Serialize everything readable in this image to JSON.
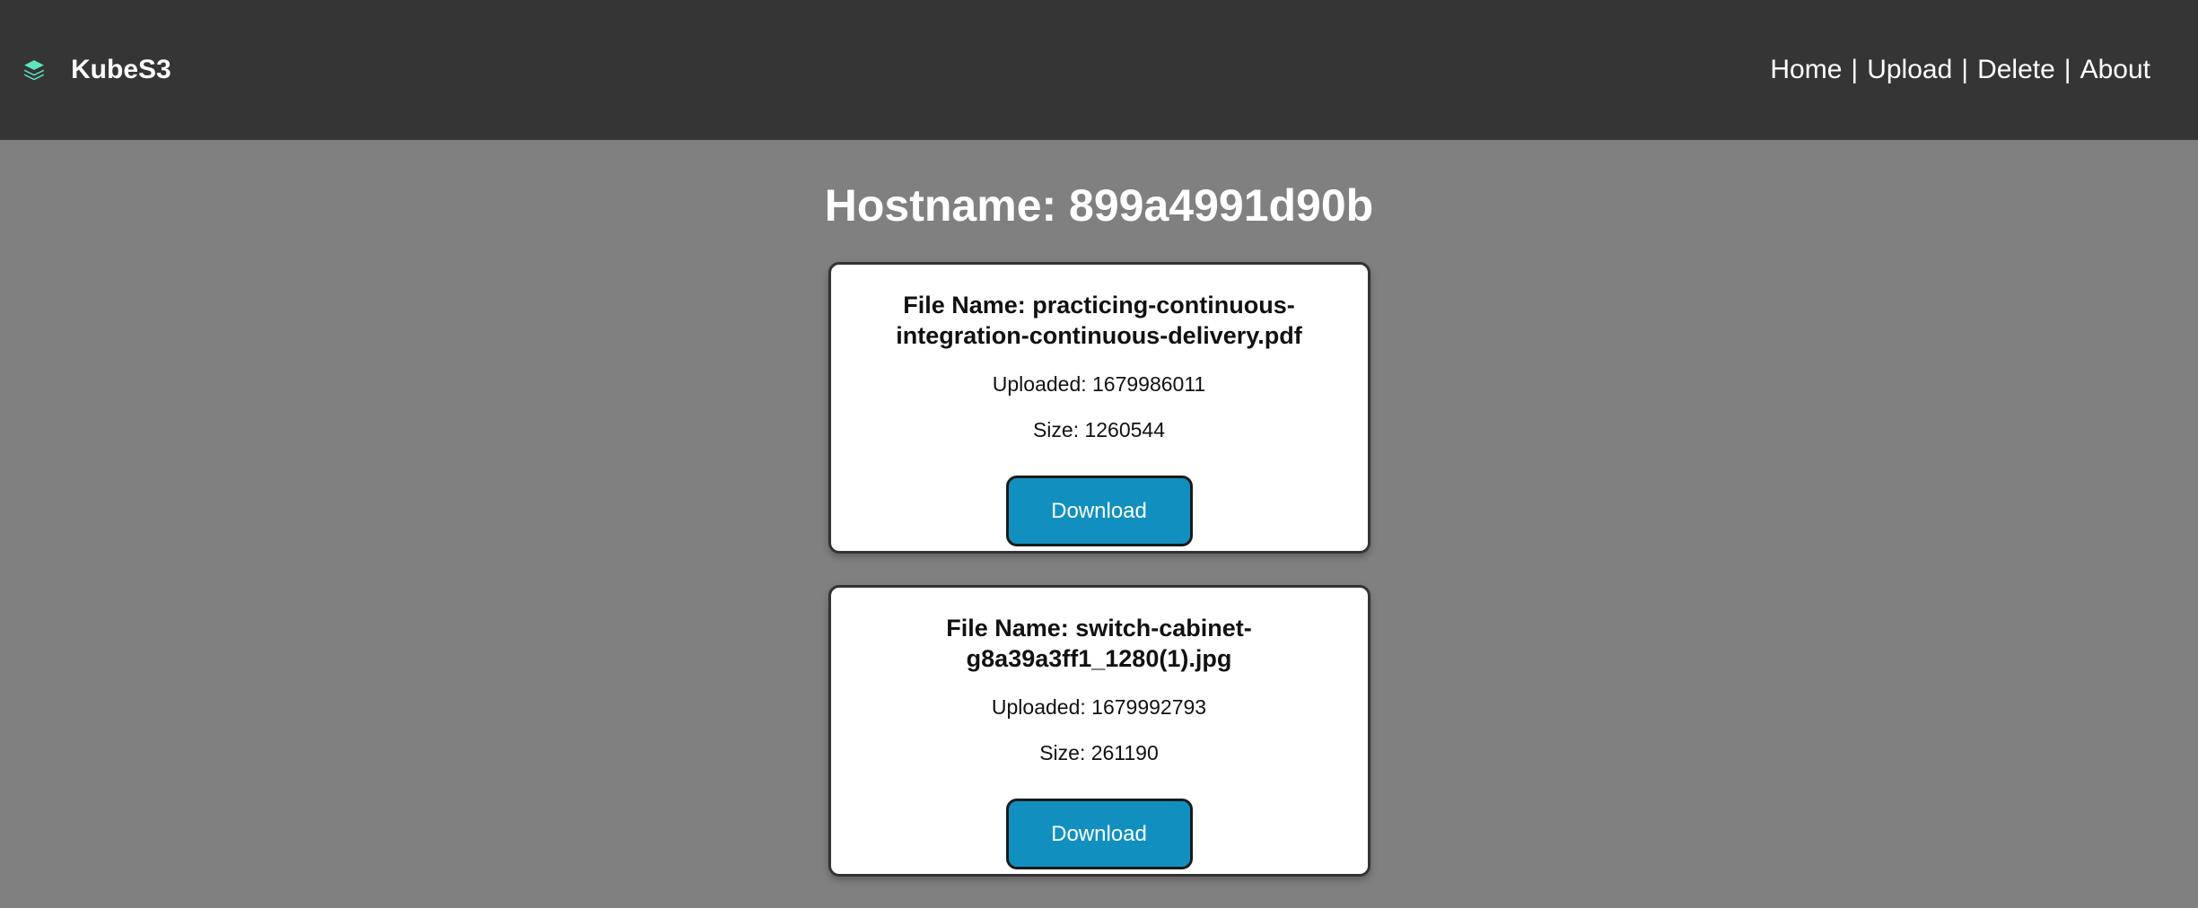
{
  "app": {
    "brand_name": "KubeS3",
    "brand_icon": "layers-icon",
    "brand_icon_color": "#5ee6c0"
  },
  "nav": {
    "items": [
      {
        "label": "Home"
      },
      {
        "label": "Upload"
      },
      {
        "label": "Delete"
      },
      {
        "label": "About"
      }
    ],
    "separator": "|"
  },
  "page": {
    "hostname_label": "Hostname: 899a4991d90b"
  },
  "files": [
    {
      "name_label": "File Name: practicing-continuous-integration-continuous-delivery.pdf",
      "uploaded_label": "Uploaded: 1679986011",
      "size_label": "Size: 1260544",
      "download_label": "Download"
    },
    {
      "name_label": "File Name: switch-cabinet-g8a39a3ff1_1280(1).jpg",
      "uploaded_label": "Uploaded: 1679992793",
      "size_label": "Size: 261190",
      "download_label": "Download"
    }
  ],
  "colors": {
    "navbar_bg": "#353535",
    "page_bg": "#808080",
    "button_bg": "#1190c0"
  }
}
